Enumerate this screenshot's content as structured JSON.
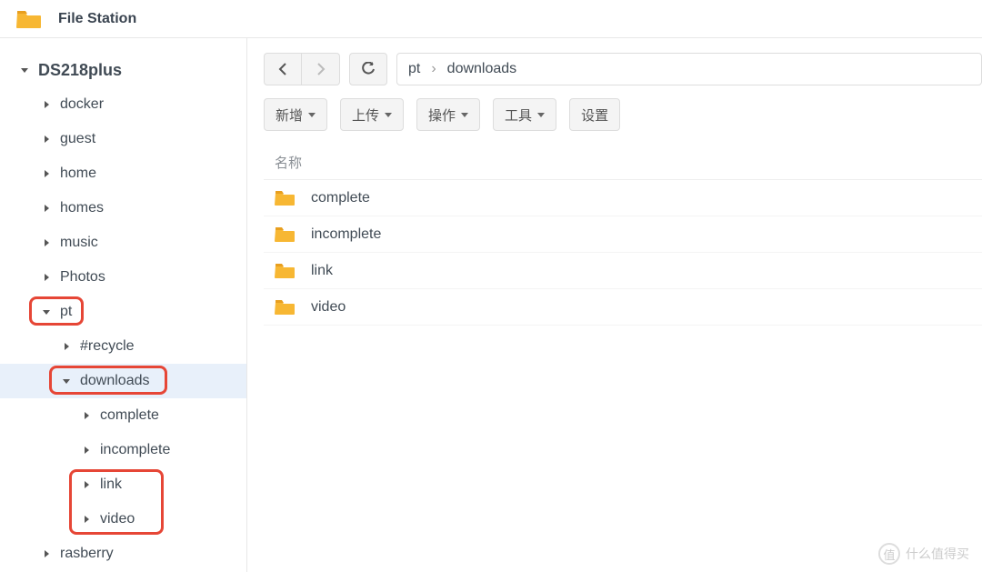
{
  "app": {
    "title": "File Station"
  },
  "tree": {
    "root": "DS218plus",
    "items": [
      {
        "label": "docker",
        "indent": 1,
        "expanded": false
      },
      {
        "label": "guest",
        "indent": 1,
        "expanded": false
      },
      {
        "label": "home",
        "indent": 1,
        "expanded": false
      },
      {
        "label": "homes",
        "indent": 1,
        "expanded": false
      },
      {
        "label": "music",
        "indent": 1,
        "expanded": false
      },
      {
        "label": "Photos",
        "indent": 1,
        "expanded": false
      },
      {
        "label": "pt",
        "indent": 1,
        "expanded": true,
        "highlight": true
      },
      {
        "label": "#recycle",
        "indent": 2,
        "expanded": false
      },
      {
        "label": "downloads",
        "indent": 2,
        "expanded": true,
        "selected": true,
        "highlight": true
      },
      {
        "label": "complete",
        "indent": 3,
        "expanded": false
      },
      {
        "label": "incomplete",
        "indent": 3,
        "expanded": false
      },
      {
        "label": "link",
        "indent": 3,
        "expanded": false,
        "highlight_group": "lv"
      },
      {
        "label": "video",
        "indent": 3,
        "expanded": false,
        "highlight_group": "lv"
      },
      {
        "label": "rasberry",
        "indent": 1,
        "expanded": false
      }
    ]
  },
  "breadcrumb": {
    "parts": [
      "pt",
      "downloads"
    ]
  },
  "toolbar": {
    "new_label": "新增",
    "upload_label": "上传",
    "action_label": "操作",
    "tools_label": "工具",
    "settings_label": "设置"
  },
  "columns": {
    "name": "名称"
  },
  "files": [
    {
      "name": "complete"
    },
    {
      "name": "incomplete"
    },
    {
      "name": "link"
    },
    {
      "name": "video"
    }
  ],
  "watermark": {
    "text": "什么值得买",
    "badge": "值"
  }
}
